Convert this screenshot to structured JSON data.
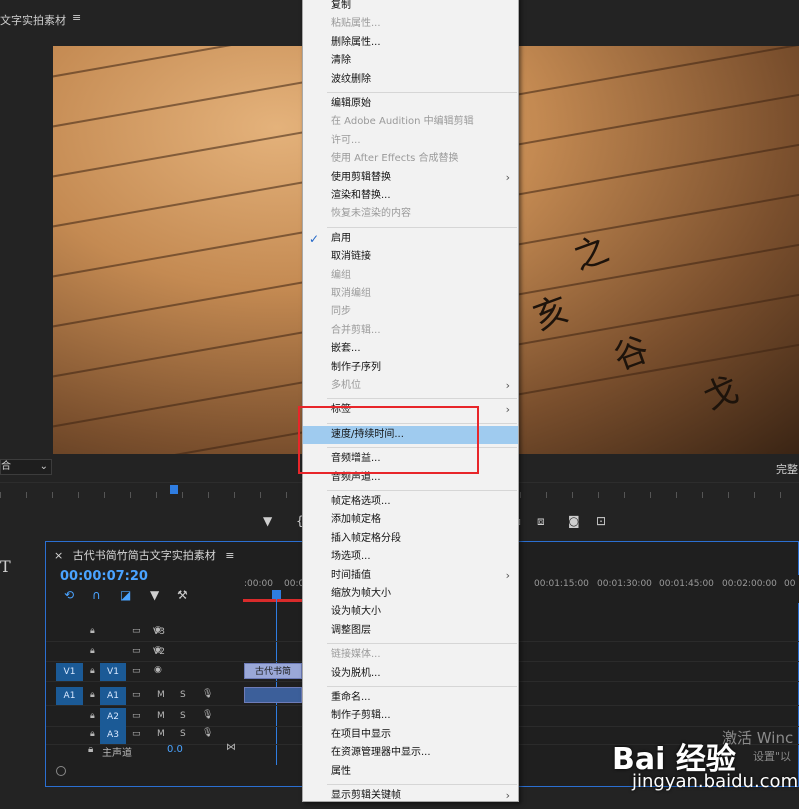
{
  "monitor": {
    "title": "文字实拍素材",
    "menu_icon": "≡",
    "fit_dropdown": "合",
    "full_label": "完整"
  },
  "transport": {
    "marker_icon": "marker-icon",
    "buttons": [
      "▼",
      "{",
      "⧉",
      "⧈",
      "◙",
      "⊡"
    ]
  },
  "timeline": {
    "tab_close": "×",
    "tab_title": "古代书简竹简古文字实拍素材",
    "tab_menu": "≡",
    "timecode": "00:00:07:20",
    "tool_text": "T",
    "ruler_labels": [
      ":00:00",
      "00:0",
      "00:01:15:00",
      "00:01:30:00",
      "00:01:45:00",
      "00:02:00:00",
      "00"
    ],
    "tracks": [
      {
        "id": "V3",
        "src": "",
        "tgt": "V3",
        "kind": "video"
      },
      {
        "id": "V2",
        "src": "",
        "tgt": "V2",
        "kind": "video"
      },
      {
        "id": "V1",
        "src": "V1",
        "tgt": "V1",
        "kind": "video"
      },
      {
        "id": "A1",
        "src": "A1",
        "tgt": "A1",
        "kind": "audio"
      },
      {
        "id": "A2",
        "src": "",
        "tgt": "A2",
        "kind": "audio"
      },
      {
        "id": "A3",
        "src": "",
        "tgt": "A3",
        "kind": "audio"
      }
    ],
    "clip_label": "古代书简",
    "master_label": "主声道",
    "master_value": "0.0",
    "mute": "M",
    "solo": "S"
  },
  "context_menu": {
    "items": [
      {
        "label": "复制",
        "disabled": false
      },
      {
        "label": "粘贴属性...",
        "disabled": true
      },
      {
        "label": "删除属性...",
        "disabled": false
      },
      {
        "label": "清除",
        "disabled": false
      },
      {
        "label": "波纹删除",
        "disabled": false
      },
      {
        "sep": true
      },
      {
        "label": "编辑原始",
        "disabled": false
      },
      {
        "label": "在 Adobe Audition 中编辑剪辑",
        "disabled": true
      },
      {
        "label": "许可...",
        "disabled": true
      },
      {
        "label": "使用 After Effects 合成替换",
        "disabled": true
      },
      {
        "label": "使用剪辑替换",
        "disabled": false,
        "submenu": true
      },
      {
        "label": "渲染和替换...",
        "disabled": false
      },
      {
        "label": "恢复未渲染的内容",
        "disabled": true
      },
      {
        "sep": true
      },
      {
        "label": "启用",
        "disabled": false,
        "checked": true
      },
      {
        "label": "取消链接",
        "disabled": false
      },
      {
        "label": "编组",
        "disabled": true
      },
      {
        "label": "取消编组",
        "disabled": true
      },
      {
        "label": "同步",
        "disabled": true
      },
      {
        "label": "合并剪辑...",
        "disabled": true
      },
      {
        "label": "嵌套...",
        "disabled": false
      },
      {
        "label": "制作子序列",
        "disabled": false
      },
      {
        "label": "多机位",
        "disabled": true,
        "submenu": true
      },
      {
        "sep": true
      },
      {
        "label": "标签",
        "disabled": false,
        "submenu": true
      },
      {
        "sep": true
      },
      {
        "label": "速度/持续时间...",
        "disabled": false,
        "highlight": true
      },
      {
        "sep": true
      },
      {
        "label": "音频增益...",
        "disabled": false
      },
      {
        "label": "音频声道...",
        "disabled": false
      },
      {
        "sep": true
      },
      {
        "label": "帧定格选项...",
        "disabled": false
      },
      {
        "label": "添加帧定格",
        "disabled": false
      },
      {
        "label": "插入帧定格分段",
        "disabled": false
      },
      {
        "label": "场选项...",
        "disabled": false
      },
      {
        "label": "时间插值",
        "disabled": false,
        "submenu": true
      },
      {
        "label": "缩放为帧大小",
        "disabled": false
      },
      {
        "label": "设为帧大小",
        "disabled": false
      },
      {
        "label": "调整图层",
        "disabled": false
      },
      {
        "sep": true
      },
      {
        "label": "链接媒体...",
        "disabled": true
      },
      {
        "label": "设为脱机...",
        "disabled": false
      },
      {
        "sep": true
      },
      {
        "label": "重命名...",
        "disabled": false
      },
      {
        "label": "制作子剪辑...",
        "disabled": false
      },
      {
        "label": "在项目中显示",
        "disabled": false
      },
      {
        "label": "在资源管理器中显示...",
        "disabled": false
      },
      {
        "label": "属性",
        "disabled": false
      },
      {
        "sep": true
      },
      {
        "label": "显示剪辑关键帧",
        "disabled": false,
        "submenu": true
      }
    ],
    "submenu_arrow": "›",
    "check_mark": "✓"
  },
  "watermark": {
    "activate": "激活 Winc",
    "setting": "设置\"以",
    "baidu": "Bai 经验",
    "url": "jingyan.baidu.com"
  },
  "colors": {
    "accent": "#2f7de1",
    "timecode": "#4aa3ff",
    "highlight": "#9fcbef",
    "annotation": "#e8262a"
  }
}
